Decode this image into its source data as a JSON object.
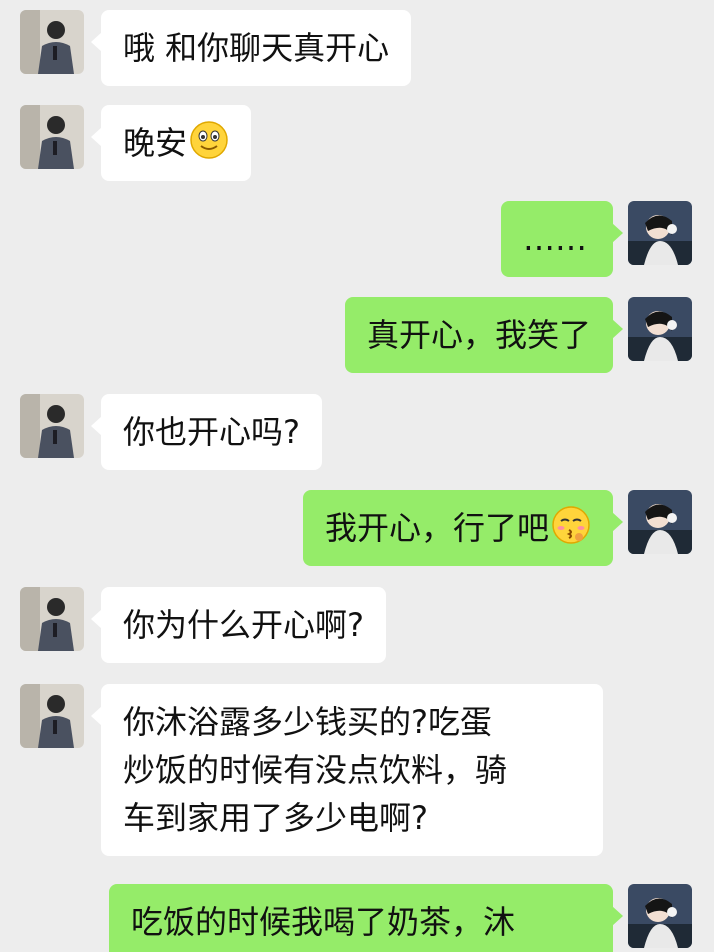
{
  "messages": [
    {
      "side": "left",
      "text": "哦 和你聊天真开心"
    },
    {
      "side": "left",
      "text": "晚安",
      "emoji": "smiling-face-emoji"
    },
    {
      "side": "right",
      "text": "……"
    },
    {
      "side": "right",
      "text": "真开心，我笑了"
    },
    {
      "side": "left",
      "text": "你也开心吗?"
    },
    {
      "side": "right",
      "text": "我开心，行了吧",
      "emoji": "kissing-face-emoji"
    },
    {
      "side": "left",
      "text": "你为什么开心啊?"
    },
    {
      "side": "left",
      "lines": [
        "你沐浴露多少钱买的?吃蛋",
        "炒饭的时候有没点饮料，骑",
        "车到家用了多少电啊?"
      ]
    },
    {
      "side": "right",
      "text": "吃饭的时候我喝了奶茶，沐"
    }
  ],
  "colors": {
    "background": "#ededed",
    "incoming_bubble": "#ffffff",
    "outgoing_bubble": "#95ec69"
  }
}
